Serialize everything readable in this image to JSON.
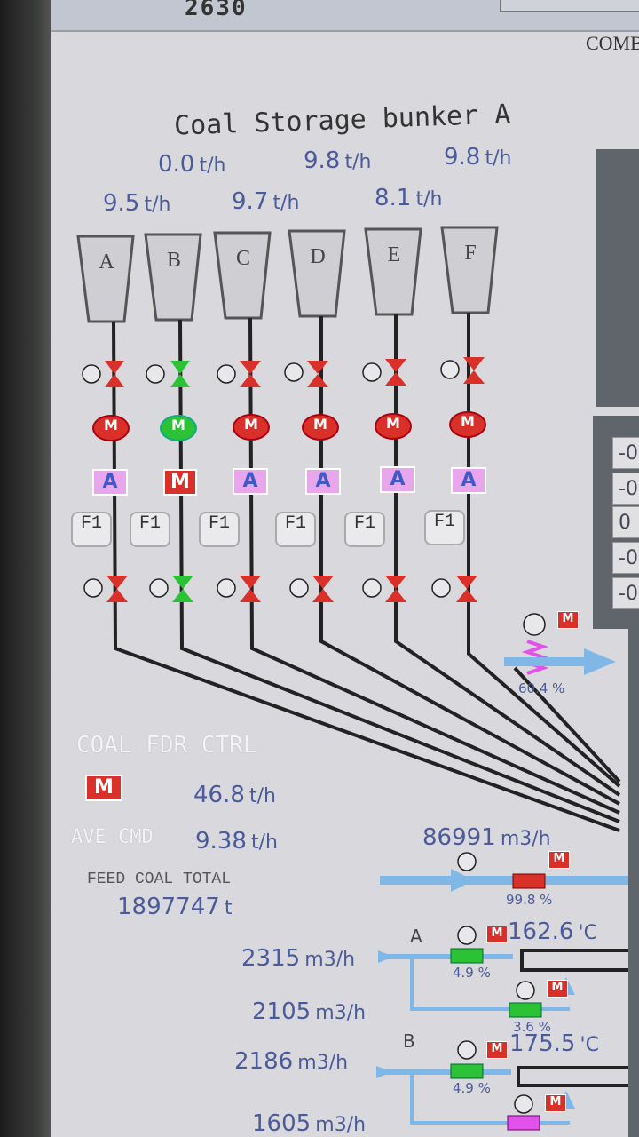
{
  "header": {
    "code": "2630",
    "comb_label": "COMB"
  },
  "title": "Coal Storage bunker A",
  "top_rates": [
    {
      "value": "0.0",
      "unit": "t/h"
    },
    {
      "value": "9.8",
      "unit": "t/h"
    },
    {
      "value": "9.8",
      "unit": "t/h"
    }
  ],
  "second_rates": [
    {
      "value": "9.5",
      "unit": "t/h"
    },
    {
      "value": "9.7",
      "unit": "t/h"
    },
    {
      "value": "8.1",
      "unit": "t/h"
    }
  ],
  "bunkers": [
    {
      "letter": "A",
      "mode": "A",
      "feeder": "F1",
      "valve_color": "red"
    },
    {
      "letter": "B",
      "mode": "M",
      "feeder": "F1",
      "valve_color": "green"
    },
    {
      "letter": "C",
      "mode": "A",
      "feeder": "F1",
      "valve_color": "red"
    },
    {
      "letter": "D",
      "mode": "A",
      "feeder": "F1",
      "valve_color": "red"
    },
    {
      "letter": "E",
      "mode": "A",
      "feeder": "F1",
      "valve_color": "red"
    },
    {
      "letter": "F",
      "mode": "A",
      "feeder": "F1",
      "valve_color": "red"
    }
  ],
  "motor_symbol": "M",
  "coal_feeder_control": {
    "label": "COAL FDR CTRL",
    "mode": "M",
    "rate": {
      "value": "46.8",
      "unit": "t/h"
    },
    "ave_cmd_label": "AVE CMD",
    "ave_cmd": {
      "value": "9.38",
      "unit": "t/h"
    }
  },
  "feed_coal_total": {
    "label": "FEED COAL TOTAL",
    "value": "1897747",
    "unit": "t"
  },
  "damper_pct": "60.4",
  "air_flow": {
    "main": {
      "value": "86991",
      "unit": "m3/h",
      "damper_pct": "99.8"
    },
    "line_a": {
      "label": "A",
      "temp": "162.6",
      "temp_unit": "'C",
      "flow1": "2315",
      "flow2": "2105",
      "unit": "m3/h",
      "pct1": "4.9",
      "pct2": "3.6"
    },
    "line_b": {
      "label": "B",
      "temp": "175.5",
      "temp_unit": "'C",
      "flow1": "2186",
      "flow2": "1605",
      "unit": "m3/h",
      "pct1": "4.9"
    }
  },
  "right_boxes": [
    "-0",
    "-0",
    "0",
    "-0",
    "-0"
  ],
  "colors": {
    "valve_red": "#d9312a",
    "valve_green": "#2cc236",
    "mode_auto": "#e8a6ec",
    "value_text": "#4a5a9a",
    "air_pipe": "#7fb8e6"
  }
}
